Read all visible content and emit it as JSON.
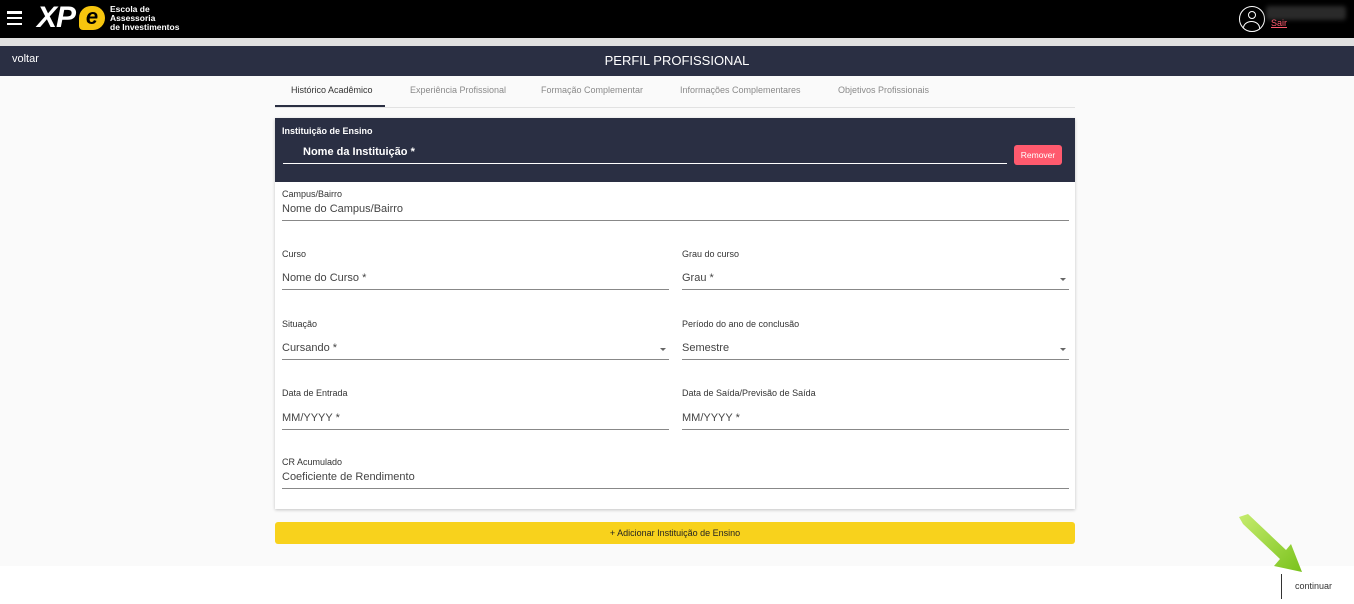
{
  "header": {
    "logo_mark": "XP",
    "logo_e": "e",
    "logo_lines": [
      "Escola de",
      "Assessoria",
      "de Investimentos"
    ],
    "logout": "Sair"
  },
  "titlebar": {
    "back": "voltar",
    "title": "PERFIL PROFISSIONAL"
  },
  "tabs": [
    {
      "label": "Histórico Acadêmico",
      "active": true
    },
    {
      "label": "Experiência Profissional"
    },
    {
      "label": "Formação Complementar"
    },
    {
      "label": "Informações Complementares"
    },
    {
      "label": "Objetivos Profissionais"
    }
  ],
  "form": {
    "section_label": "Instituição de Ensino",
    "institution_placeholder": "Nome da Instituição *",
    "remove_label": "Remover",
    "campus_label": "Campus/Bairro",
    "campus_placeholder": "Nome do Campus/Bairro",
    "course_label": "Curso",
    "course_placeholder": "Nome do Curso *",
    "degree_label": "Grau do curso",
    "degree_placeholder": "Grau *",
    "status_label": "Situação",
    "status_value": "Cursando *",
    "period_label": "Período do ano de conclusão",
    "period_value": "Semestre",
    "start_label": "Data de Entrada",
    "start_placeholder": "MM/YYYY *",
    "end_label": "Data de Saída/Previsão de Saída",
    "end_placeholder": "MM/YYYY *",
    "cr_label": "CR Acumulado",
    "cr_placeholder": "Coeficiente de Rendimento"
  },
  "add_button": "+ Adicionar Instituição de Ensino",
  "continue_button": "continuar",
  "colors": {
    "navy": "#2a2f43",
    "accent_yellow": "#f8d21c",
    "danger": "#ff5a6e",
    "arrow_green": "#8ccc2c"
  }
}
